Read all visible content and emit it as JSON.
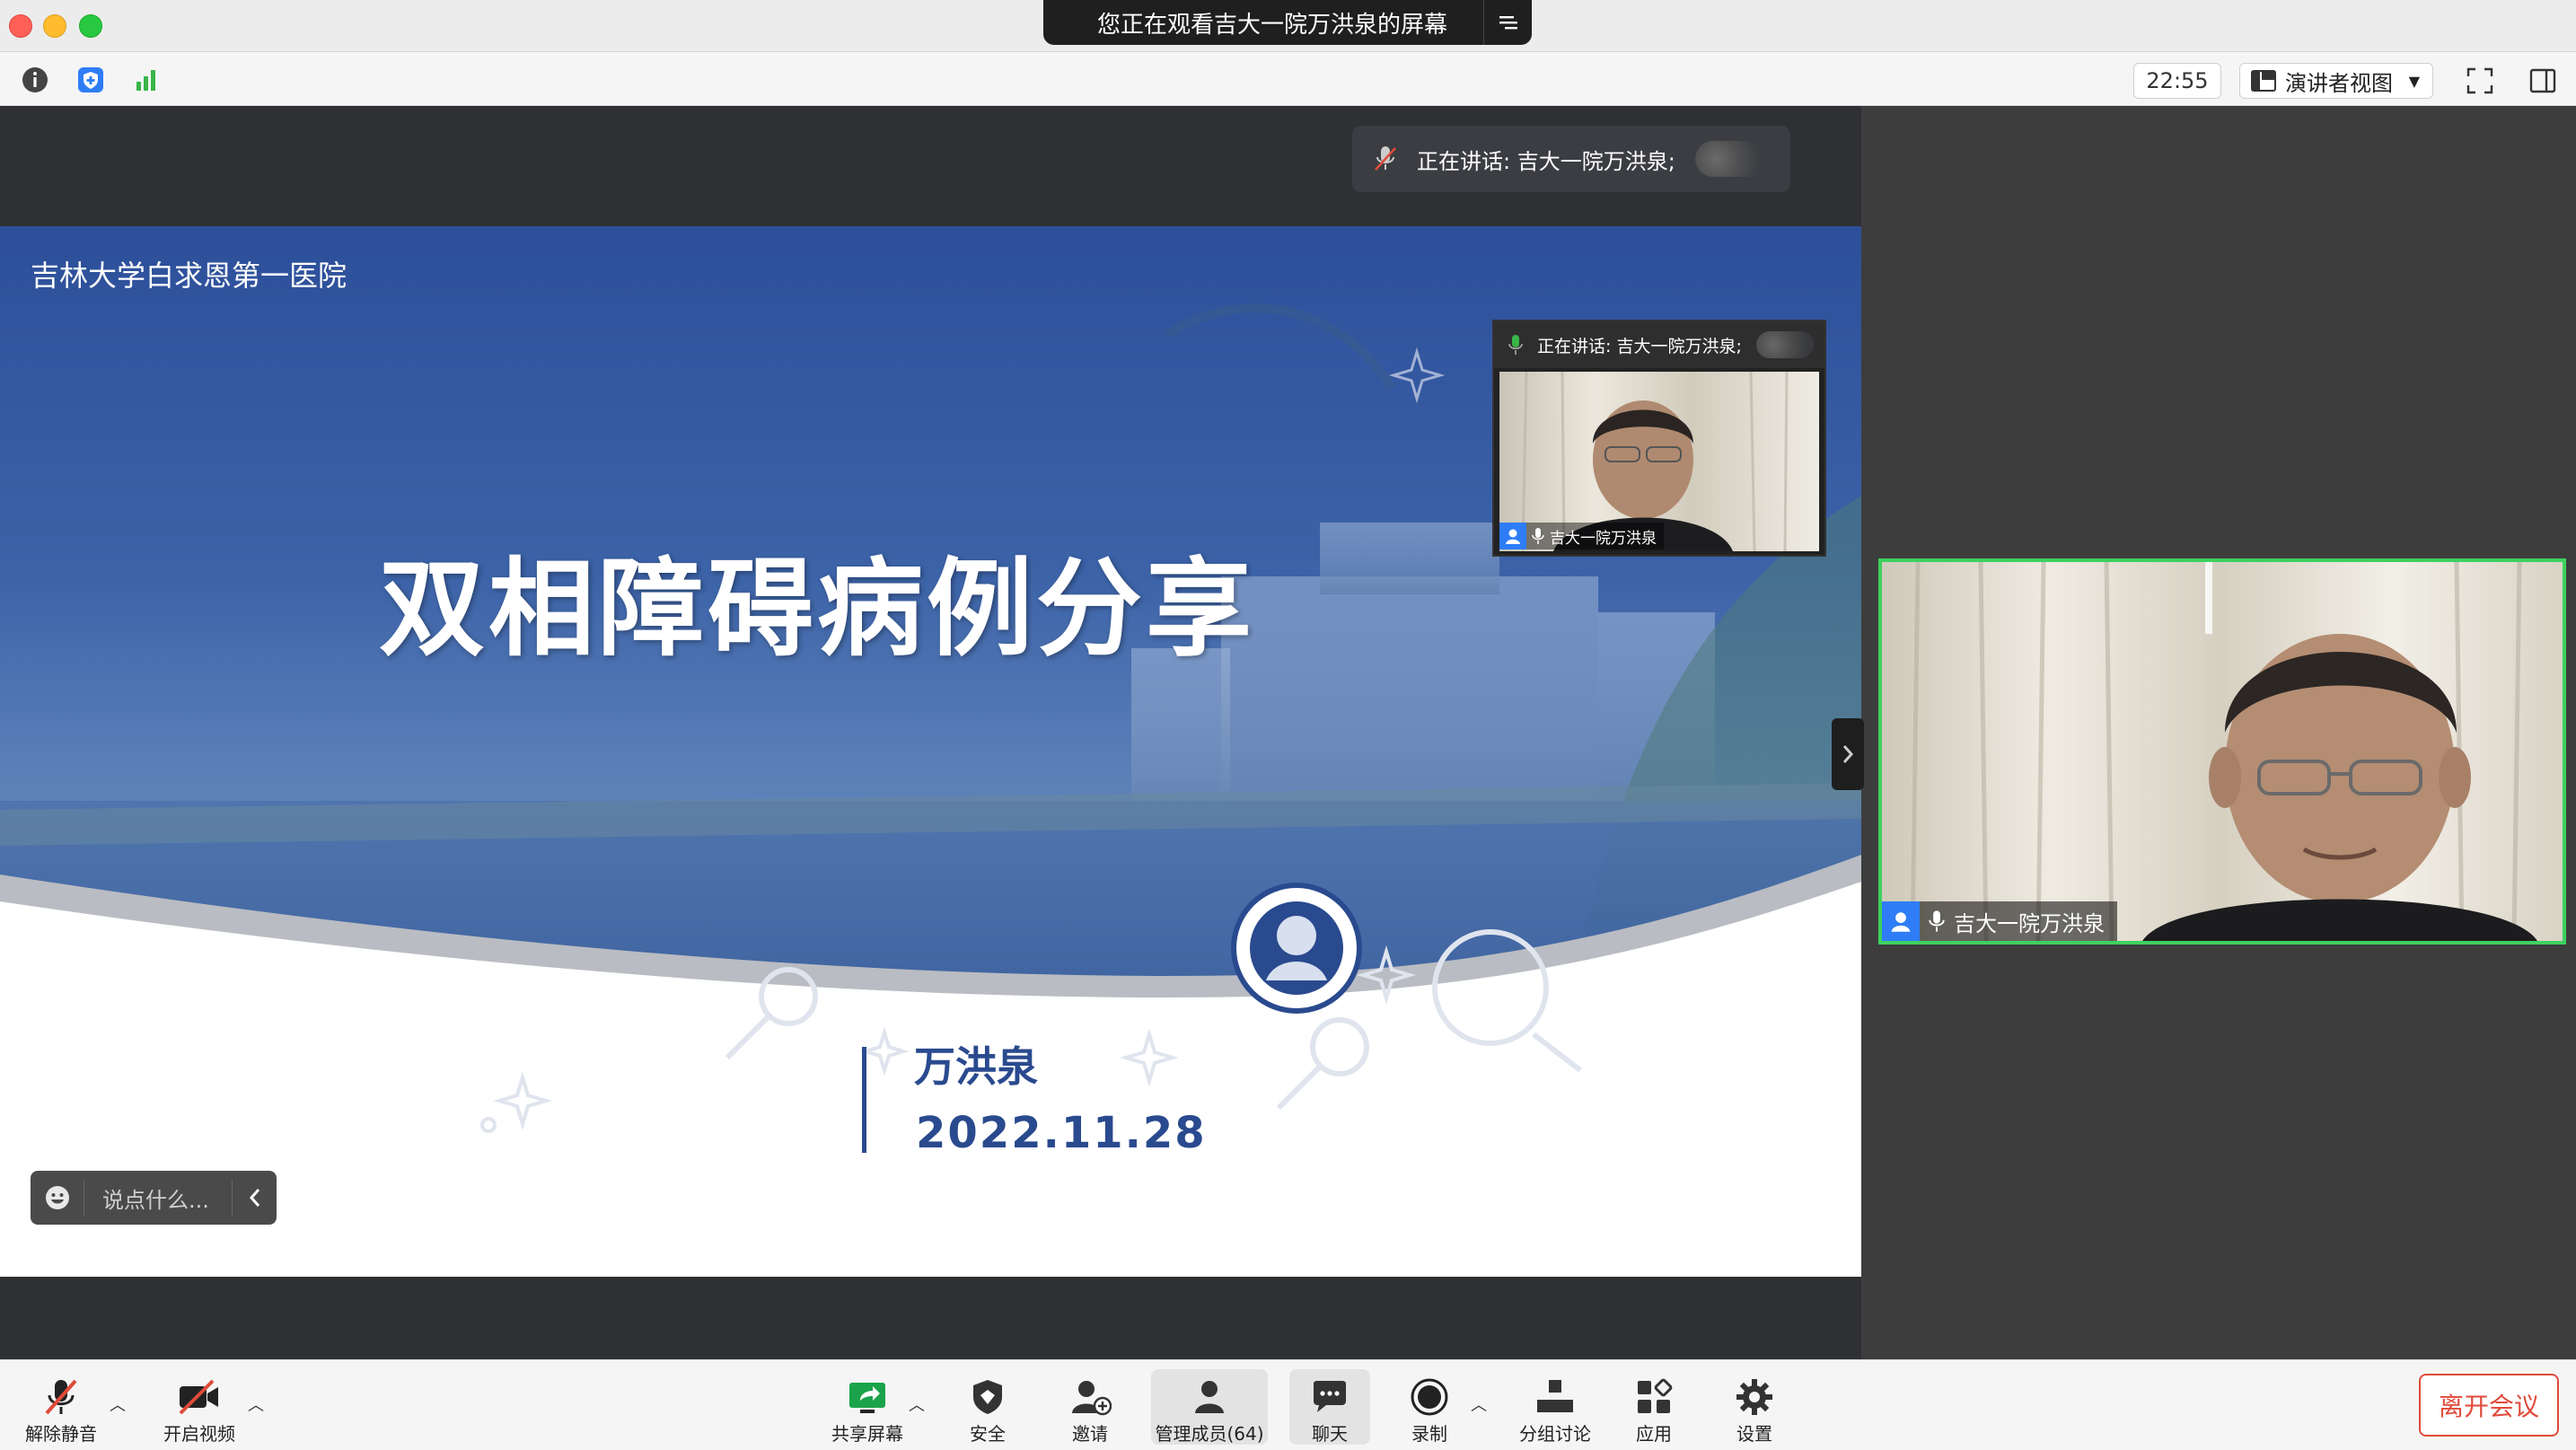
{
  "window": {
    "share_banner": "您正在观看吉大一院万洪泉的屏幕",
    "menu_icon": "list-menu-icon"
  },
  "toolbar": {
    "info_icon": "info-icon",
    "security_icon": "shield-icon",
    "signal_icon": "signal-bars-icon",
    "clock": "22:55",
    "view_mode": "演讲者视图",
    "fullscreen_icon": "fullscreen-icon",
    "sidebar_icon": "sidebar-toggle-icon"
  },
  "share": {
    "speaking_label": "正在讲话: 吉大一院万洪泉;"
  },
  "slide": {
    "hospital_name": "吉林大学白求恩第一医院",
    "title": "双相障碍病例分享",
    "presenter": "万洪泉",
    "date": "2022.11.28"
  },
  "chat": {
    "placeholder": "说点什么..."
  },
  "mini_video": {
    "speaking_label": "正在讲话: 吉大一院万洪泉;",
    "name": "吉大一院万洪泉"
  },
  "main_video": {
    "name": "吉大一院万洪泉"
  },
  "controls": {
    "unmute": "解除静音",
    "start_video": "开启视频",
    "share_screen": "共享屏幕",
    "security": "安全",
    "invite": "邀请",
    "participants": "管理成员(64)",
    "chat": "聊天",
    "record": "录制",
    "breakout": "分组讨论",
    "apps": "应用",
    "settings": "设置",
    "leave": "离开会议"
  },
  "colors": {
    "accent_blue": "#2e7df6",
    "speaker_border": "#3ed15f",
    "leave_red": "#e04a3a",
    "slide_blue": "#2d4f9a"
  }
}
